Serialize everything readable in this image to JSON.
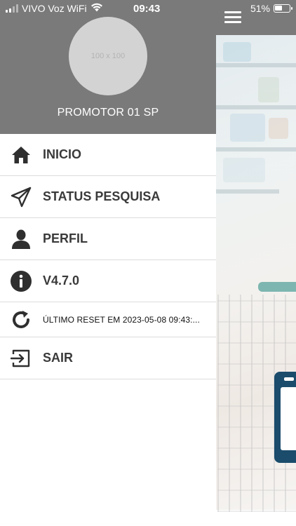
{
  "status_bar": {
    "carrier": "VIVO Voz WiFi",
    "time": "09:43",
    "battery_percent": "51%",
    "battery_level": 0.51,
    "signal_bars_active": 2,
    "signal_bars_total": 4
  },
  "drawer": {
    "avatar_placeholder": "100 x 100",
    "user_name": "PROMOTOR 01 SP",
    "menu": [
      {
        "label": "INICIO",
        "icon": "home-icon"
      },
      {
        "label": "STATUS PESQUISA",
        "icon": "send-icon"
      },
      {
        "label": "PERFIL",
        "icon": "user-icon"
      },
      {
        "label": "V4.7.0",
        "icon": "info-icon"
      },
      {
        "label": "ÚLTIMO RESET EM 2023-05-08 09:43:...",
        "icon": "refresh-icon"
      },
      {
        "label": "SAIR",
        "icon": "logout-icon"
      }
    ]
  },
  "background": {
    "menu_icon": "hamburger-icon",
    "header_color": "#7a7a7a"
  }
}
